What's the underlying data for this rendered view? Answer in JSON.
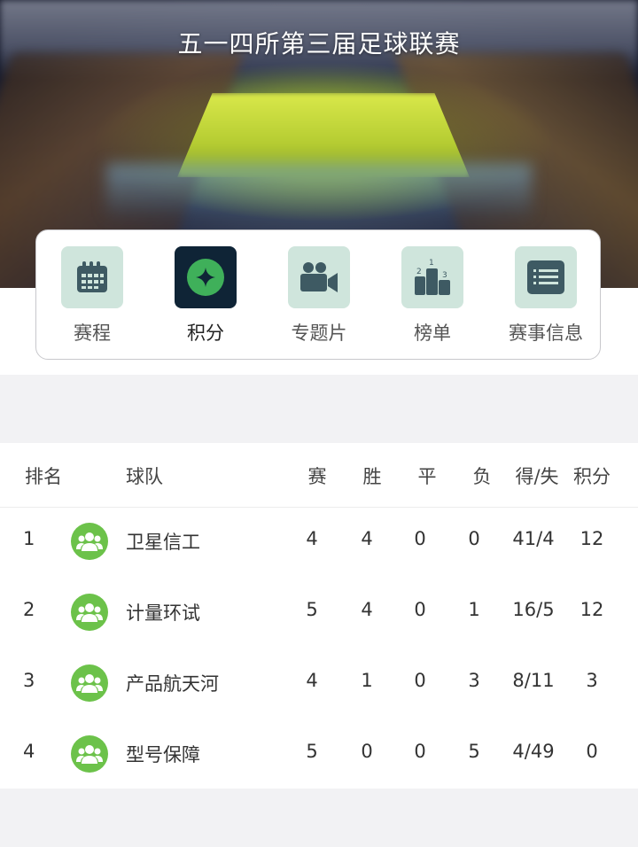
{
  "header": {
    "title": "五一四所第三届足球联赛"
  },
  "menu": [
    {
      "label": "赛程",
      "icon": "calendar-icon",
      "active": false
    },
    {
      "label": "积分",
      "icon": "points-icon",
      "active": true
    },
    {
      "label": "专题片",
      "icon": "video-camera-icon",
      "active": false
    },
    {
      "label": "榜单",
      "icon": "podium-icon",
      "active": false
    },
    {
      "label": "赛事信息",
      "icon": "list-icon",
      "active": false
    }
  ],
  "colors": {
    "accent_green": "#6cc24a",
    "menu_icon_bg": "#cfe5dc",
    "menu_active_bg": "#0f2436",
    "menu_icon_fg": "#3e5a63"
  },
  "table": {
    "headers": {
      "rank": "排名",
      "team": "球队",
      "played": "赛",
      "won": "胜",
      "draw": "平",
      "lost": "负",
      "goals": "得/失",
      "points": "积分"
    },
    "rows": [
      {
        "rank": "1",
        "team": "卫星信工",
        "played": "4",
        "won": "4",
        "draw": "0",
        "lost": "0",
        "goals": "41/4",
        "points": "12"
      },
      {
        "rank": "2",
        "team": "计量环试",
        "played": "5",
        "won": "4",
        "draw": "0",
        "lost": "1",
        "goals": "16/5",
        "points": "12"
      },
      {
        "rank": "3",
        "team": "产品航天河",
        "played": "4",
        "won": "1",
        "draw": "0",
        "lost": "3",
        "goals": "8/11",
        "points": "3"
      },
      {
        "rank": "4",
        "team": "型号保障",
        "played": "5",
        "won": "0",
        "draw": "0",
        "lost": "5",
        "goals": "4/49",
        "points": "0"
      }
    ]
  }
}
